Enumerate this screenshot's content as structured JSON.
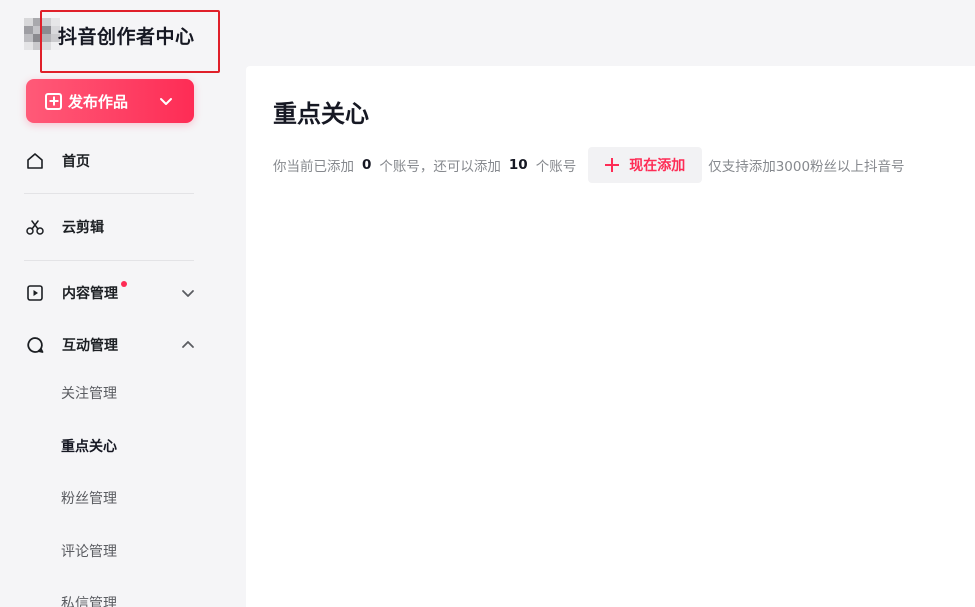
{
  "brand": {
    "title": "抖音创作者中心"
  },
  "sidebar": {
    "publish_label": "发布作品",
    "items": [
      {
        "label": "首页",
        "icon": "home-icon"
      },
      {
        "label": "云剪辑",
        "icon": "scissors-icon"
      },
      {
        "label": "内容管理",
        "icon": "play-square-icon",
        "has_dot": true,
        "expanded": false
      },
      {
        "label": "互动管理",
        "icon": "chat-bubble-icon",
        "expanded": true
      }
    ],
    "sub_items": [
      {
        "label": "关注管理",
        "active": false
      },
      {
        "label": "重点关心",
        "active": true
      },
      {
        "label": "粉丝管理",
        "active": false
      },
      {
        "label": "评论管理",
        "active": false
      },
      {
        "label": "私信管理",
        "active": false
      }
    ]
  },
  "main": {
    "title": "重点关心",
    "info": {
      "prefix": "你当前已添加",
      "added_count": "0",
      "mid": "个账号，还可以添加",
      "remaining_count": "10",
      "suffix": "个账号",
      "add_button": "现在添加",
      "tip": "仅支持添加3000粉丝以上抖音号"
    }
  },
  "colors": {
    "accent": "#fe2c55",
    "highlight_border": "#e0202a"
  }
}
